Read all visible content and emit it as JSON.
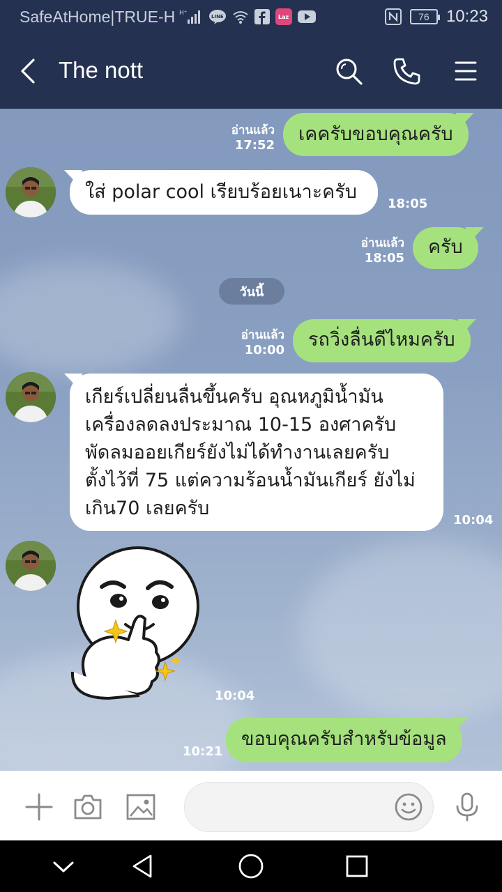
{
  "status_bar": {
    "carrier": "SafeAtHome|TRUE-H",
    "battery": "76",
    "time": "10:23"
  },
  "header": {
    "title": "The nott"
  },
  "date_separator": "วันนี้",
  "messages": [
    {
      "side": "out",
      "text": "เคครับขอบคุณครับ",
      "read": "อ่านแล้ว",
      "time": "17:52"
    },
    {
      "side": "in",
      "text": "ใส่ polar cool เรียบร้อยเนาะครับ",
      "time": "18:05"
    },
    {
      "side": "out",
      "text": "ครับ",
      "read": "อ่านแล้ว",
      "time": "18:05"
    },
    {
      "side": "out",
      "text": "รถวิ่งลื่นดีไหมครับ",
      "read": "อ่านแล้ว",
      "time": "10:00"
    },
    {
      "side": "in",
      "lines": [
        "เกียร์เปลี่ยนลื่นขึ้นครับ อุณหภูมิน้ำมัน",
        "เครื่องลดลงประมาณ 10-15 องศาครับ",
        "พัดลมออยเกียร์ยังไม่ได้ทำงานเลยครับ",
        "ตั้งไว้ที่ 75 แต่ความร้อนน้ำมันเกียร์ ยังไม่",
        "เกิน70 เลยครับ"
      ],
      "time": "10:04"
    },
    {
      "side": "in",
      "sticker": "thumbs-up-sticker",
      "time": "10:04"
    },
    {
      "side": "out",
      "text": "ขอบคุณครับสำหรับข้อมูล",
      "time": "10:21"
    }
  ],
  "input": {
    "placeholder": ""
  },
  "colors": {
    "header_bg": "#243150",
    "bubble_out": "#a5e27d",
    "bubble_in": "#ffffff",
    "chat_bg": "#8399bd"
  }
}
